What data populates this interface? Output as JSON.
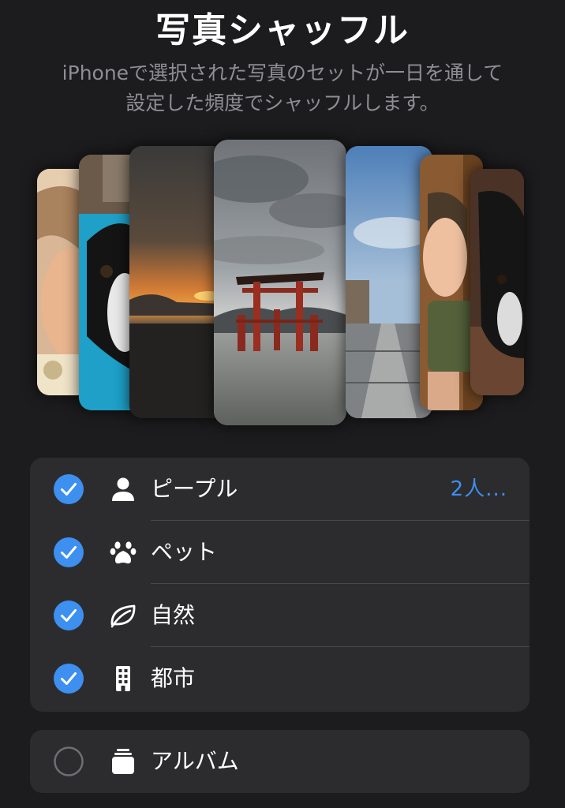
{
  "header": {
    "title": "写真シャッフル",
    "subtitle_line1": "iPhoneで選択された写真のセットが一日を通して",
    "subtitle_line2": "設定した頻度でシャッフルします。"
  },
  "categories": [
    {
      "label": "ピープル",
      "value": "2人...",
      "checked": true,
      "icon": "person-icon"
    },
    {
      "label": "ペット",
      "checked": true,
      "icon": "paw-icon"
    },
    {
      "label": "自然",
      "checked": true,
      "icon": "leaf-icon"
    },
    {
      "label": "都市",
      "checked": true,
      "icon": "building-icon"
    }
  ],
  "album": {
    "label": "アルバム",
    "checked": false,
    "icon": "album-stack-icon"
  },
  "colors": {
    "accent": "#3d8ff0",
    "background": "#1c1c1e",
    "group": "#2c2c2e"
  }
}
